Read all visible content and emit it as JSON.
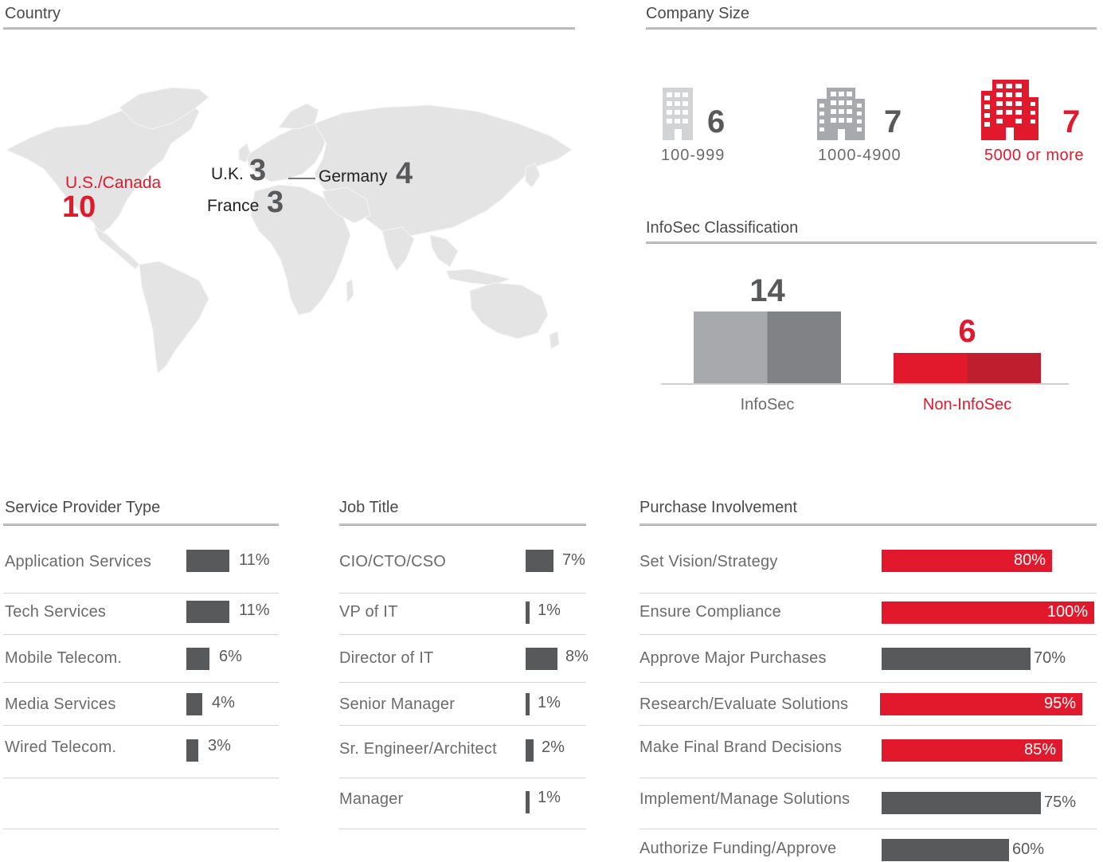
{
  "colors": {
    "accent": "#e2192c",
    "dark_bar": "#58595b",
    "light_bar": "#a7a9ac",
    "map": "#e3e3e3"
  },
  "country": {
    "title": "Country",
    "markers": [
      {
        "label": "U.S./Canada",
        "value": "10",
        "highlight": true
      },
      {
        "label": "U.K.",
        "value": "3"
      },
      {
        "label": "France",
        "value": "3"
      },
      {
        "label": "Germany",
        "value": "4"
      }
    ]
  },
  "company_size": {
    "title": "Company Size",
    "items": [
      {
        "icon": "small-building-icon",
        "value": "6",
        "label": "100-999"
      },
      {
        "icon": "medium-building-icon",
        "value": "7",
        "label": "1000-4900"
      },
      {
        "icon": "large-building-icon",
        "value": "7",
        "label": "5000 or more",
        "highlight": true
      }
    ]
  },
  "infosec": {
    "title": "InfoSec Classification",
    "chart_data": {
      "type": "bar",
      "categories": [
        "InfoSec",
        "Non-InfoSec"
      ],
      "values": [
        14,
        6
      ],
      "title": "InfoSec Classification"
    },
    "value_labels": [
      "14",
      "6"
    ],
    "category_labels": [
      "InfoSec",
      "Non-InfoSec"
    ]
  },
  "chart_data": [
    {
      "type": "bar",
      "title": "Service Provider Type",
      "categories": [
        "Application Services",
        "Tech Services",
        "Mobile Telecom.",
        "Media Services",
        "Wired Telecom."
      ],
      "values": [
        11,
        11,
        6,
        4,
        3
      ]
    },
    {
      "type": "bar",
      "title": "Job Title",
      "categories": [
        "CIO/CTO/CSO",
        "VP of IT",
        "Director of IT",
        "Senior Manager",
        "Sr. Engineer/Architect",
        "Manager"
      ],
      "values": [
        7,
        1,
        8,
        1,
        2,
        1
      ]
    },
    {
      "type": "bar",
      "title": "Purchase Involvement",
      "categories": [
        "Set Vision/Strategy",
        "Ensure Compliance",
        "Approve Major Purchases",
        "Research/Evaluate Solutions",
        "Make Final Brand Decisions",
        "Implement/Manage Solutions",
        "Authorize Funding/Approve"
      ],
      "values": [
        80,
        100,
        70,
        95,
        85,
        75,
        60
      ],
      "highlight": [
        true,
        true,
        false,
        true,
        true,
        false,
        false
      ]
    }
  ],
  "service_provider": {
    "title": "Service Provider Type",
    "rows": [
      {
        "label": "Application Services",
        "pct": "11%"
      },
      {
        "label": "Tech Services",
        "pct": "11%"
      },
      {
        "label": "Mobile Telecom.",
        "pct": "6%"
      },
      {
        "label": "Media Services",
        "pct": "4%"
      },
      {
        "label": "Wired Telecom.",
        "pct": "3%"
      }
    ]
  },
  "job_title": {
    "title": "Job Title",
    "rows": [
      {
        "label": "CIO/CTO/CSO",
        "pct": "7%"
      },
      {
        "label": "VP of IT",
        "pct": "1%"
      },
      {
        "label": "Director of IT",
        "pct": "8%"
      },
      {
        "label": "Senior Manager",
        "pct": "1%"
      },
      {
        "label": "Sr. Engineer/Architect",
        "pct": "2%"
      },
      {
        "label": "Manager",
        "pct": "1%"
      }
    ]
  },
  "purchase": {
    "title": "Purchase Involvement",
    "rows": [
      {
        "label": "Set Vision/Strategy",
        "pct": "80%"
      },
      {
        "label": "Ensure Compliance",
        "pct": "100%"
      },
      {
        "label": "Approve Major Purchases",
        "pct": "70%"
      },
      {
        "label": "Research/Evaluate Solutions",
        "pct": "95%"
      },
      {
        "label": "Make Final Brand Decisions",
        "pct": "85%"
      },
      {
        "label": "Implement/Manage Solutions",
        "pct": "75%"
      },
      {
        "label": "Authorize Funding/Approve",
        "pct": "60%"
      }
    ]
  }
}
